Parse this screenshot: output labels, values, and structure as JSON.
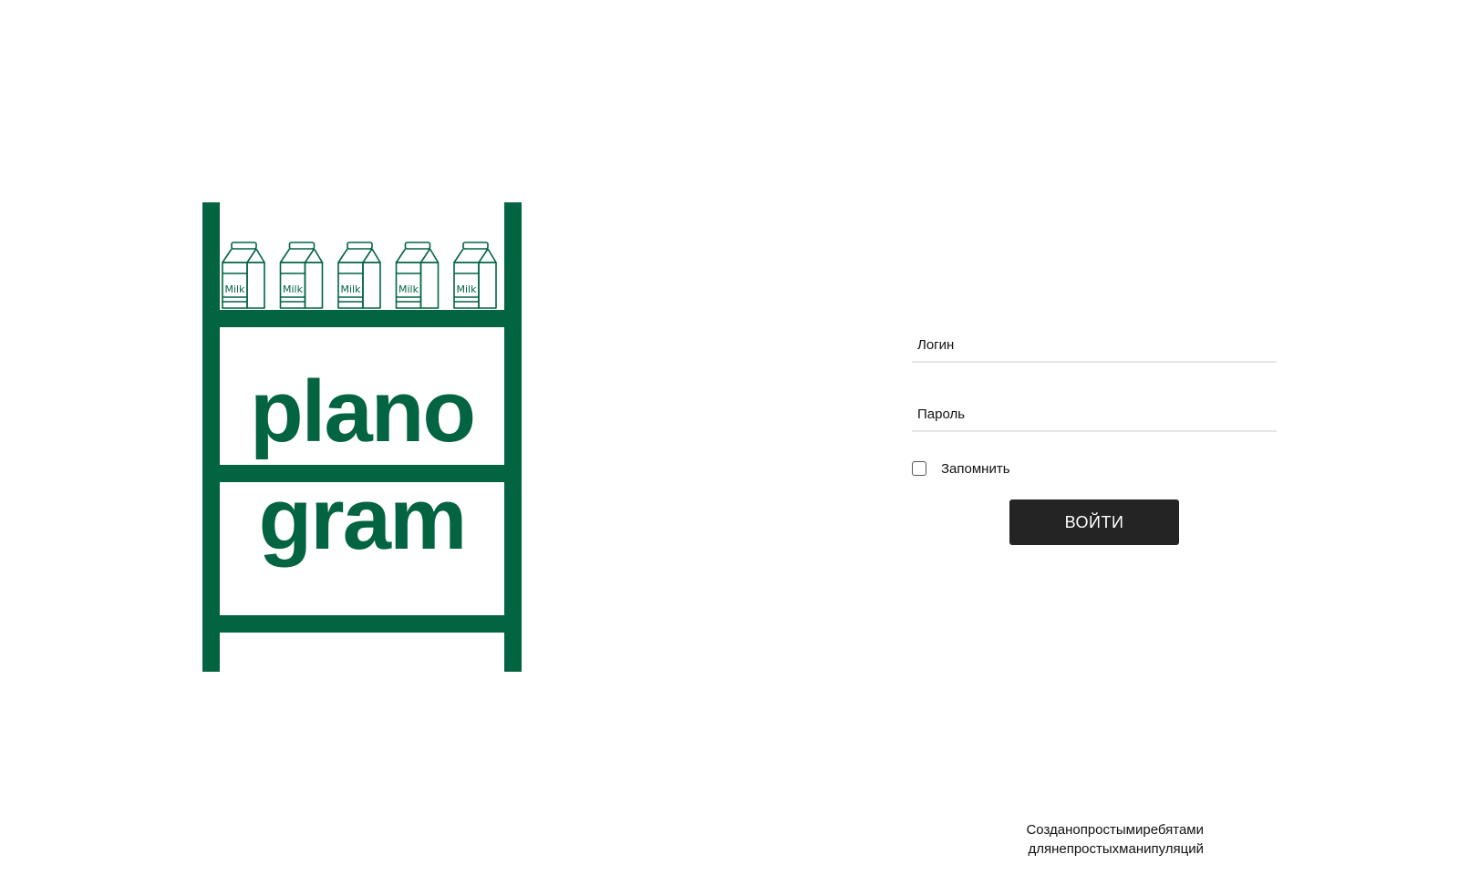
{
  "logo": {
    "line1": "plano",
    "line2": "gram",
    "carton_label": "Milk",
    "carton_count": 5,
    "brand_color": "#026440"
  },
  "login_form": {
    "login_placeholder": "Логин",
    "password_placeholder": "Пароль",
    "remember_label": "Запомнить",
    "remember_checked": false,
    "submit_label": "ВОЙТИ"
  },
  "footer": {
    "line1": "Созданопростымиребятами",
    "line2": "длянепростыхманипуляций"
  }
}
